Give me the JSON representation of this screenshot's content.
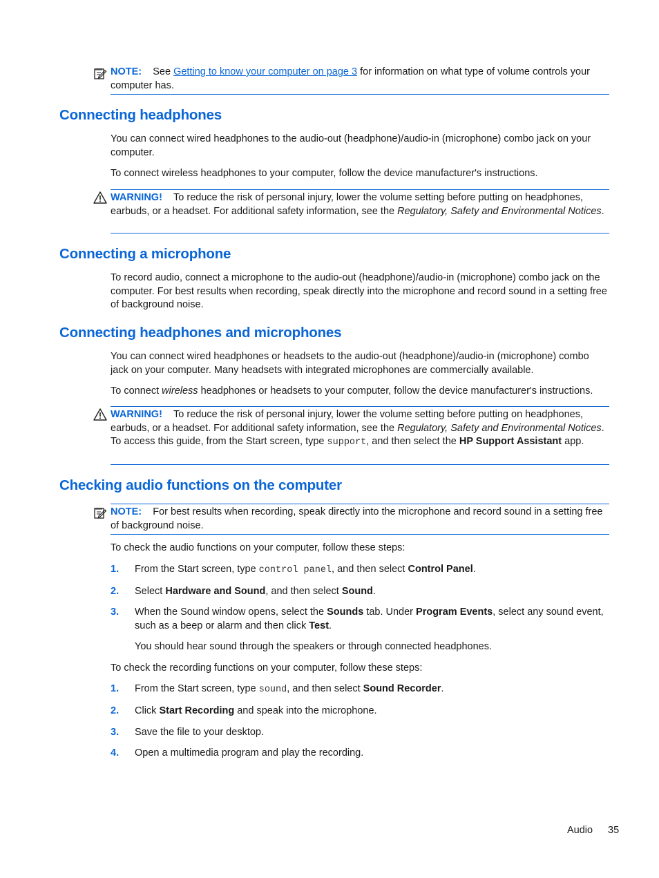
{
  "note1": {
    "label": "NOTE:",
    "pre": "See ",
    "link": "Getting to know your computer on page 3",
    "post": " for information on what type of volume controls your computer has."
  },
  "sections": {
    "headphones": {
      "title": "Connecting headphones",
      "p1": "You can connect wired headphones to the audio-out (headphone)/audio-in (microphone) combo jack on your computer.",
      "p2": "To connect wireless headphones to your computer, follow the device manufacturer's instructions.",
      "warning": {
        "label": "WARNING!",
        "text": "To reduce the risk of personal injury, lower the volume setting before putting on headphones, earbuds, or a headset. For additional safety information, see the ",
        "italic": "Regulatory, Safety and Environmental Notices",
        "end": "."
      }
    },
    "microphone": {
      "title": "Connecting a microphone",
      "p1": "To record audio, connect a microphone to the audio-out (headphone)/audio-in (microphone) combo jack on the computer. For best results when recording, speak directly into the microphone and record sound in a setting free of background noise."
    },
    "both": {
      "title": "Connecting headphones and microphones",
      "p1": "You can connect wired headphones or headsets to the audio-out (headphone)/audio-in (microphone) combo jack on your computer. Many headsets with integrated microphones are commercially available.",
      "p2_pre": "To connect ",
      "p2_italic": "wireless",
      "p2_post": " headphones or headsets to your computer, follow the device manufacturer's instructions.",
      "warning": {
        "label": "WARNING!",
        "text": "To reduce the risk of personal injury, lower the volume setting before putting on headphones, earbuds, or a headset. For additional safety information, see the ",
        "italic": "Regulatory, Safety and Environmental Notices",
        "mid": ". To access this guide, from the Start screen, type ",
        "code": "support",
        "mid2": ", and then select the ",
        "bold": "HP Support Assistant",
        "end": " app."
      }
    },
    "checking": {
      "title": "Checking audio functions on the computer",
      "note": {
        "label": "NOTE:",
        "text": "For best results when recording, speak directly into the microphone and record sound in a setting free of background noise."
      },
      "intro1": "To check the audio functions on your computer, follow these steps:",
      "steps1": [
        {
          "num": "1.",
          "a": "From the Start screen, type ",
          "code": "control panel",
          "b": ", and then select ",
          "bold": "Control Panel",
          "c": "."
        },
        {
          "num": "2.",
          "a": "Select ",
          "bold1": "Hardware and Sound",
          "b": ", and then select ",
          "bold2": "Sound",
          "c": "."
        },
        {
          "num": "3.",
          "a": "When the Sound window opens, select the ",
          "bold1": "Sounds",
          "b": " tab. Under ",
          "bold2": "Program Events",
          "c": ", select any sound event, such as a beep or alarm and then click ",
          "bold3": "Test",
          "d": "."
        }
      ],
      "step3_followup": "You should hear sound through the speakers or through connected headphones.",
      "intro2": "To check the recording functions on your computer, follow these steps:",
      "steps2": [
        {
          "num": "1.",
          "a": "From the Start screen, type ",
          "code": "sound",
          "b": ", and then select ",
          "bold": "Sound Recorder",
          "c": "."
        },
        {
          "num": "2.",
          "a": "Click ",
          "bold": "Start Recording",
          "b": " and speak into the microphone."
        },
        {
          "num": "3.",
          "a": "Save the file to your desktop."
        },
        {
          "num": "4.",
          "a": "Open a multimedia program and play the recording."
        }
      ]
    }
  },
  "footer": {
    "section": "Audio",
    "page": "35"
  }
}
